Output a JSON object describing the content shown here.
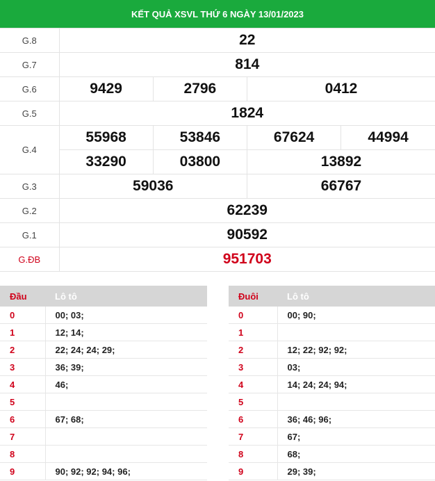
{
  "title": "KẾT QUẢ XSVL THỨ 6 NGÀY 13/01/2023",
  "prizes": {
    "g8": {
      "label": "G.8",
      "nums": [
        "22"
      ]
    },
    "g7": {
      "label": "G.7",
      "nums": [
        "814"
      ]
    },
    "g6": {
      "label": "G.6",
      "nums": [
        "9429",
        "2796",
        "0412"
      ]
    },
    "g5": {
      "label": "G.5",
      "nums": [
        "1824"
      ]
    },
    "g4": {
      "label": "G.4",
      "nums": [
        "55968",
        "53846",
        "67624",
        "44994",
        "33290",
        "03800",
        "13892"
      ]
    },
    "g3": {
      "label": "G.3",
      "nums": [
        "59036",
        "66767"
      ]
    },
    "g2": {
      "label": "G.2",
      "nums": [
        "62239"
      ]
    },
    "g1": {
      "label": "G.1",
      "nums": [
        "90592"
      ]
    },
    "gdb": {
      "label": "G.ĐB",
      "nums": [
        "951703"
      ]
    }
  },
  "dau": {
    "header_key": "Đầu",
    "header_val": "Lô tô",
    "rows": [
      {
        "k": "0",
        "v": "00; 03;"
      },
      {
        "k": "1",
        "v": "12; 14;"
      },
      {
        "k": "2",
        "v": "22; 24; 24; 29;"
      },
      {
        "k": "3",
        "v": "36; 39;"
      },
      {
        "k": "4",
        "v": "46;"
      },
      {
        "k": "5",
        "v": ""
      },
      {
        "k": "6",
        "v": "67; 68;"
      },
      {
        "k": "7",
        "v": ""
      },
      {
        "k": "8",
        "v": ""
      },
      {
        "k": "9",
        "v": "90; 92; 92; 94; 96;"
      }
    ]
  },
  "duoi": {
    "header_key": "Đuôi",
    "header_val": "Lô tô",
    "rows": [
      {
        "k": "0",
        "v": "00; 90;"
      },
      {
        "k": "1",
        "v": ""
      },
      {
        "k": "2",
        "v": "12; 22; 92; 92;"
      },
      {
        "k": "3",
        "v": "03;"
      },
      {
        "k": "4",
        "v": "14; 24; 24; 94;"
      },
      {
        "k": "5",
        "v": ""
      },
      {
        "k": "6",
        "v": "36; 46; 96;"
      },
      {
        "k": "7",
        "v": "67;"
      },
      {
        "k": "8",
        "v": "68;"
      },
      {
        "k": "9",
        "v": "29; 39;"
      }
    ]
  },
  "colors": {
    "header_green": "#1aaa3d",
    "accent_red": "#d0021b"
  }
}
